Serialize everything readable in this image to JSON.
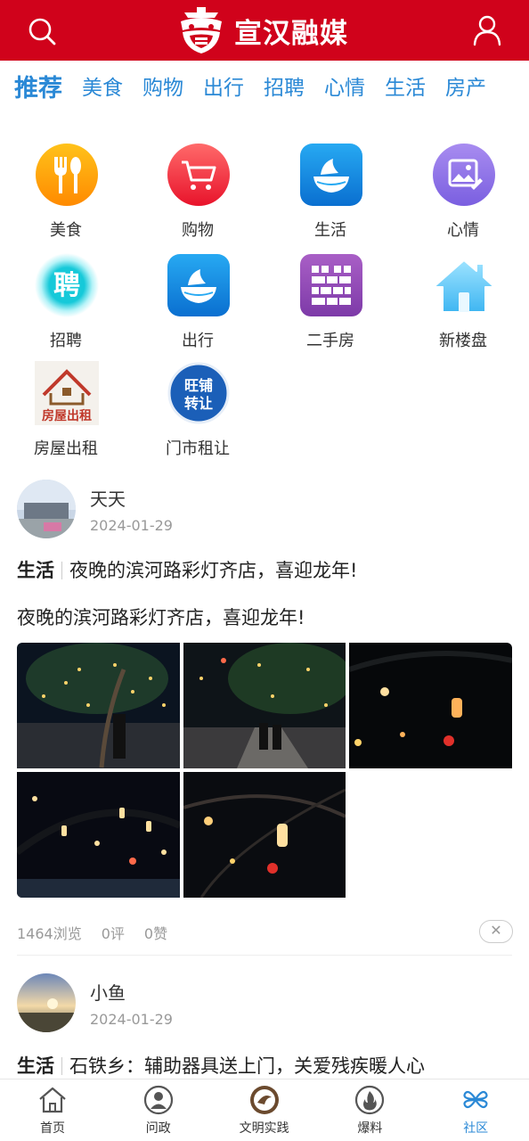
{
  "header": {
    "brand_name": "宣汉融媒",
    "search_icon": "search-icon",
    "user_icon": "user-icon",
    "colors": {
      "bar": "#d0021b"
    }
  },
  "tabs": [
    {
      "label": "推荐",
      "active": true
    },
    {
      "label": "美食"
    },
    {
      "label": "购物"
    },
    {
      "label": "出行"
    },
    {
      "label": "招聘"
    },
    {
      "label": "心情"
    },
    {
      "label": "生活"
    },
    {
      "label": "房产"
    }
  ],
  "categories": [
    {
      "label": "美食",
      "icon": "fork-spoon-icon"
    },
    {
      "label": "购物",
      "icon": "cart-icon"
    },
    {
      "label": "生活",
      "icon": "bowl-icon"
    },
    {
      "label": "心情",
      "icon": "picture-icon"
    },
    {
      "label": "招聘",
      "icon": "recruit-icon",
      "glyph": "聘"
    },
    {
      "label": "出行",
      "icon": "bowl-icon"
    },
    {
      "label": "二手房",
      "icon": "brick-wall-icon"
    },
    {
      "label": "新楼盘",
      "icon": "house-icon"
    },
    {
      "label": "房屋出租",
      "icon": "house-rent-icon",
      "text": "房屋出租"
    },
    {
      "label": "门市租让",
      "icon": "shop-transfer-icon",
      "text": "旺铺转让"
    }
  ],
  "posts": [
    {
      "author": "天天",
      "date": "2024-01-29",
      "category": "生活",
      "title": "夜晚的滨河路彩灯齐店，喜迎龙年!",
      "body": "夜晚的滨河路彩灯齐店，喜迎龙年!",
      "views": "1464浏览",
      "comments": "0评",
      "likes": "0赞",
      "close": "✕"
    },
    {
      "author": "小鱼",
      "date": "2024-01-29",
      "category": "生活",
      "title": "石铁乡：辅助器具送上门，关爱残疾暖人心"
    }
  ],
  "bottom_nav": [
    {
      "label": "首页",
      "icon": "home-icon"
    },
    {
      "label": "问政",
      "icon": "person-circle-icon"
    },
    {
      "label": "文明实践",
      "icon": "civilization-badge-icon"
    },
    {
      "label": "爆料",
      "icon": "flame-icon"
    },
    {
      "label": "社区",
      "icon": "clover-icon",
      "active": true
    }
  ]
}
